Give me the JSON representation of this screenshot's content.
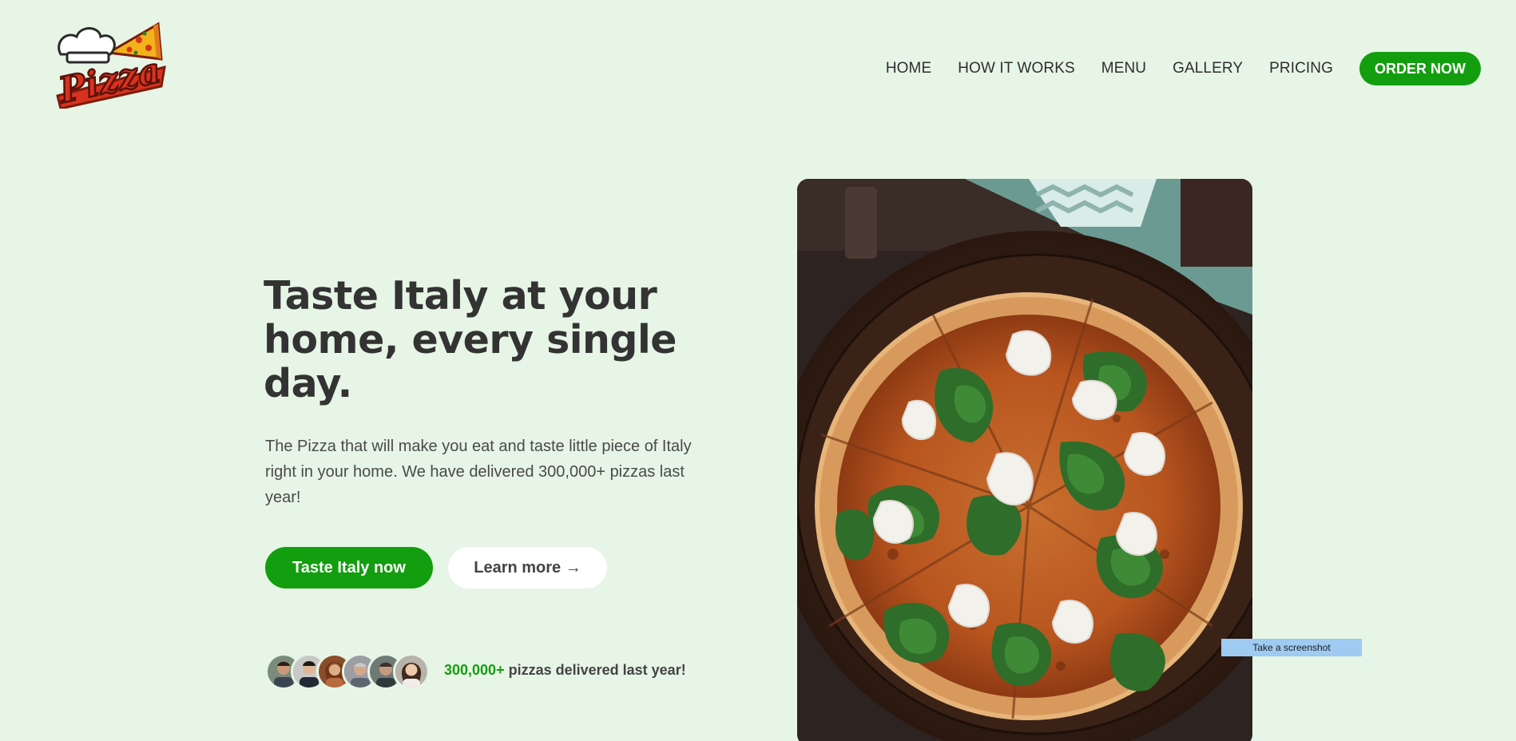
{
  "logo": {
    "text": "Pizza",
    "icon": "pizza-chef-hat-logo"
  },
  "nav": {
    "links": [
      "HOME",
      "HOW IT WORKS",
      "MENU",
      "GALLERY",
      "PRICING"
    ],
    "cta_label": "ORDER NOW"
  },
  "hero": {
    "title": "Taste Italy at your home, every single day.",
    "description": "The Pizza that will make you eat and taste little piece of Italy right in your home. We have delivered 300,000+ pizzas last year!",
    "primary_button": "Taste Italy now",
    "secondary_button": "Learn more →",
    "image": "pizza-with-greens-and-burrata-photo"
  },
  "social_proof": {
    "highlight": "300,000+",
    "text": " pizzas delivered last year!",
    "avatar_count": 6
  },
  "tooltip": {
    "label": "Take a screenshot"
  },
  "colors": {
    "background": "#e6f5e5",
    "accent": "#129e0e",
    "text": "#333333"
  }
}
